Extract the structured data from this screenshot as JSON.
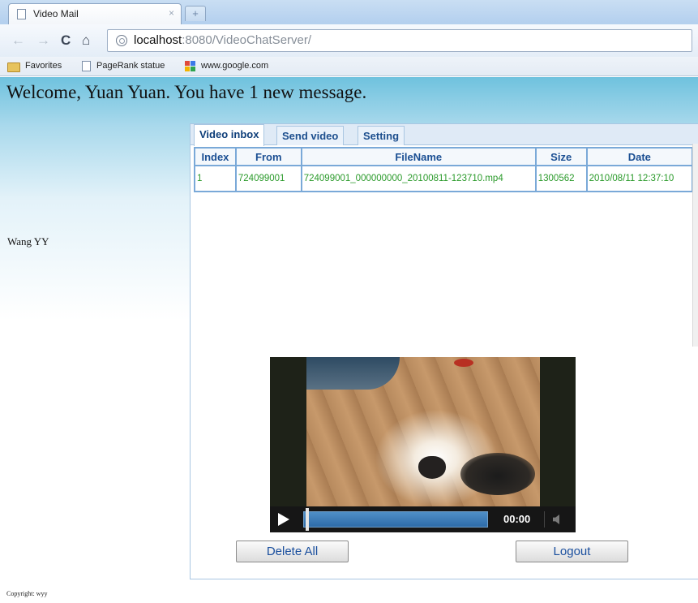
{
  "browser": {
    "tab_title": "Video Mail",
    "tab_close": "×",
    "new_tab": "+",
    "url_host": "localhost",
    "url_rest": ":8080/VideoChatServer/",
    "bookmarks": [
      {
        "label": "Favorites",
        "icon": "folder-icon"
      },
      {
        "label": "PageRank statue",
        "icon": "page-icon"
      },
      {
        "label": "www.google.com",
        "icon": "google-icon"
      }
    ],
    "nav_icons": {
      "back": "←",
      "forward": "→",
      "reload": "C",
      "home": "⌂"
    }
  },
  "page": {
    "welcome": "Welcome, Yuan Yuan. You have 1 new message.",
    "contacts": [
      "Wang YY"
    ],
    "copyright": "Copyright: wyy",
    "tabs": [
      "Video inbox",
      "Send video",
      "Setting"
    ],
    "active_tab": "Video inbox"
  },
  "inbox": {
    "columns": [
      "Index",
      "From",
      "FileName",
      "Size",
      "Date"
    ],
    "rows": [
      {
        "index": "1",
        "from": "724099001",
        "filename": "724099001_000000000_20100811-123710.mp4",
        "size": "1300562",
        "date": "2010/08/11 12:37:10"
      }
    ]
  },
  "player": {
    "time": "00:00",
    "progress": 0.0
  },
  "buttons": {
    "delete_all": "Delete All",
    "logout": "Logout"
  },
  "colors": {
    "table_text": "#2a9a2a",
    "header_text": "#1b4f93",
    "button_text": "#1a4f9e",
    "page_gradient_top": "#6fc2de"
  }
}
